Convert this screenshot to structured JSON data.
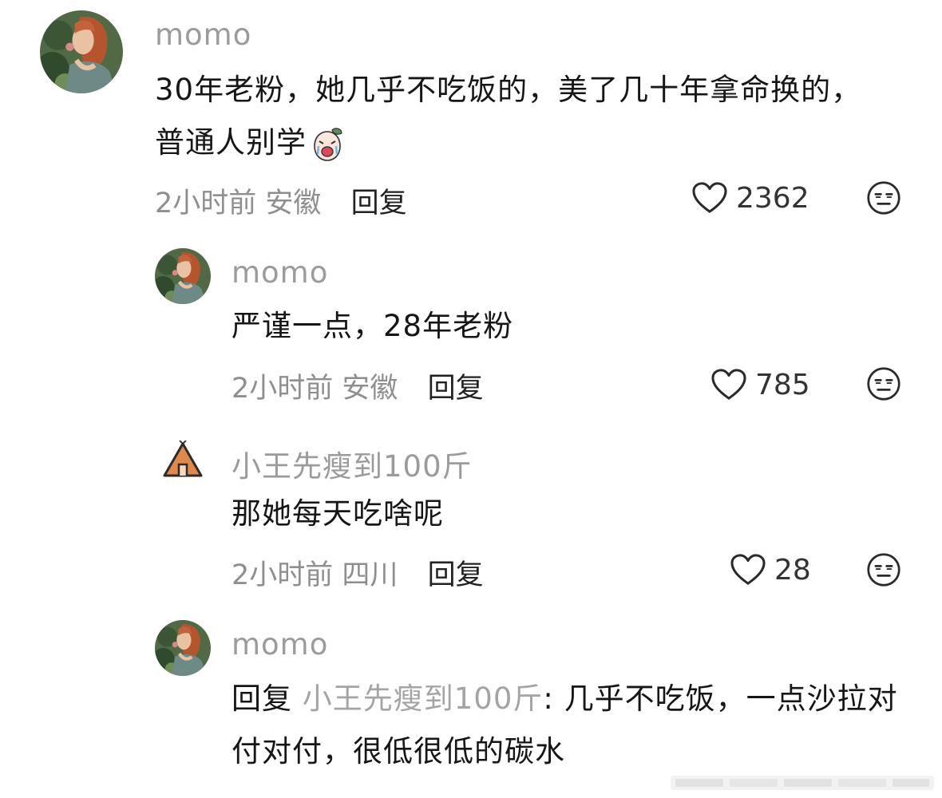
{
  "comments": [
    {
      "username": "momo",
      "text": "30年老粉，她几乎不吃饭的，美了几十年拿命换的，普通人别学",
      "time": "2小时前",
      "location": "安徽",
      "reply_label": "回复",
      "likes": "2362",
      "avatar": "portrait-avatar",
      "sticker": "crying-peach-sticker"
    },
    {
      "username": "momo",
      "text": "严谨一点，28年老粉",
      "time": "2小时前",
      "location": "安徽",
      "reply_label": "回复",
      "likes": "785",
      "avatar": "portrait-avatar"
    },
    {
      "username": "小王先瘦到100斤",
      "text": "那她每天吃啥呢",
      "time": "2小时前",
      "location": "四川",
      "reply_label": "回复",
      "likes": "28",
      "avatar": "tent-avatar"
    },
    {
      "username": "momo",
      "reply_prefix": "回复",
      "reply_to": "小王先瘦到100斤",
      "reply_sep": ": ",
      "text": "几乎不吃饭，一点沙拉对付对付，很低很低的碳水",
      "avatar": "portrait-avatar"
    }
  ],
  "icons": {
    "like": "heart-outline-icon",
    "reaction": "expressionless-face-icon"
  },
  "colors": {
    "username": "#9b9b9b",
    "text": "#161616",
    "meta": "#8f8f8f",
    "tent": "#e0894a"
  }
}
